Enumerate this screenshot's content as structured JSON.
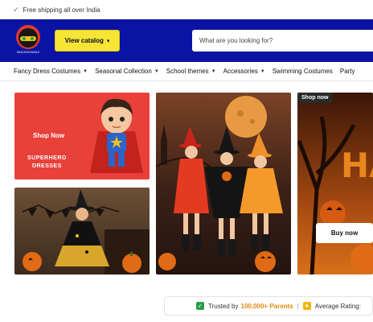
{
  "topbar": {
    "shipping_text": "Free shipping all over India",
    "check_color": "#2e9d4a"
  },
  "header": {
    "background": "#0a13a3",
    "logo_text": "DHACHOKSHASLE",
    "catalog_button": "View catalog",
    "search_placeholder": "What are you looking for?"
  },
  "nav": {
    "items": [
      {
        "label": "Fancy Dress Costumes"
      },
      {
        "label": "Seasonal Collection"
      },
      {
        "label": "School themes"
      },
      {
        "label": "Accessories"
      },
      {
        "label": "Swimming Costumes"
      },
      {
        "label": "Party"
      }
    ]
  },
  "banners": {
    "superhero": {
      "shop_now": "Shop Now",
      "title_line1": "SUPERHERO",
      "title_line2": "DRESSES"
    },
    "halloween": {
      "tag": "Shop now",
      "buy_now": "Buy now",
      "headline": "HA"
    }
  },
  "trust": {
    "prefix": "Trusted by",
    "highlight": "100,000+ Parents",
    "separator": "|",
    "rating_label": "Average Rating:"
  },
  "colors": {
    "accent_yellow": "#f6e534",
    "trust_orange": "#e18b0d",
    "banner_red": "#e9403a"
  }
}
